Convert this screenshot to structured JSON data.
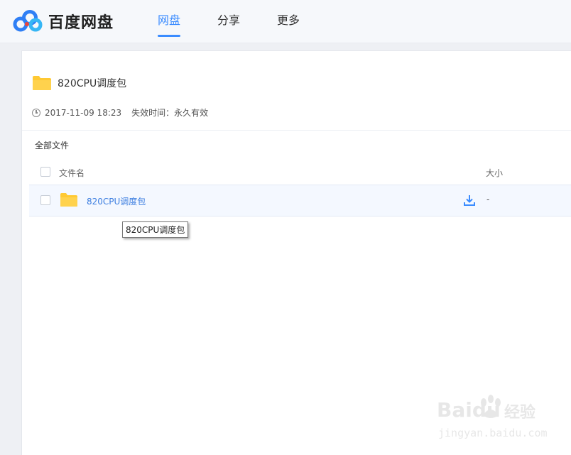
{
  "header": {
    "logo_text": "百度网盘",
    "nav": [
      {
        "label": "网盘",
        "active": true
      },
      {
        "label": "分享",
        "active": false
      },
      {
        "label": "更多",
        "active": false
      }
    ]
  },
  "share": {
    "title": "820CPU调度包",
    "created": "2017-11-09 18:23",
    "expire": "失效时间：永久有效"
  },
  "breadcrumb": "全部文件",
  "table": {
    "headers": {
      "name": "文件名",
      "size": "大小"
    },
    "rows": [
      {
        "name": "820CPU调度包",
        "size": "-",
        "type": "folder"
      }
    ]
  },
  "tooltip": "820CPU调度包",
  "watermark": {
    "brand": "Baidu",
    "product": "经验",
    "url": "jingyan.baidu.com"
  },
  "colors": {
    "accent": "#3b8cff",
    "folder": "#ffc933",
    "link": "#3b7de0"
  }
}
